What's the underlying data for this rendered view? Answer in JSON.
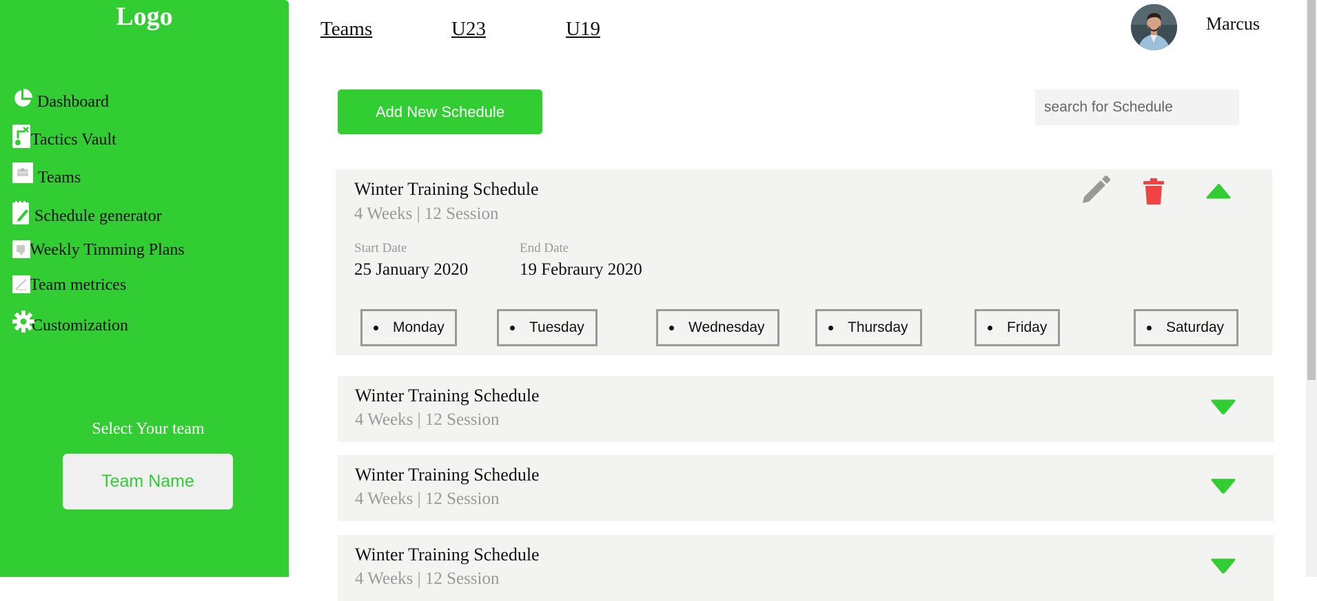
{
  "sidebar": {
    "logo": "Logo",
    "items": [
      {
        "label": "Dashboard",
        "icon": "pie-chart-icon"
      },
      {
        "label": "Tactics Vault",
        "icon": "tactics-board-icon"
      },
      {
        "label": "Teams",
        "icon": "teams-icon"
      },
      {
        "label": "Schedule generator",
        "icon": "notepad-pen-icon"
      },
      {
        "label": "Weekly Timming Plans",
        "icon": "weekly-plan-icon"
      },
      {
        "label": "Team metrices",
        "icon": "metrics-icon"
      },
      {
        "label": "Customization",
        "icon": "gear-icon"
      }
    ],
    "select_label": "Select Your team",
    "team_button": "Team Name"
  },
  "header": {
    "tabs": [
      "Teams",
      "U23",
      "U19"
    ],
    "user_name": "Marcus"
  },
  "toolbar": {
    "add_label": "Add New Schedule",
    "search_placeholder": "search for Schedule"
  },
  "schedules": [
    {
      "title": "Winter Training Schedule",
      "subtitle": "4 Weeks | 12 Session",
      "expanded": true,
      "start_label": "Start Date",
      "start_value": "25 January 2020",
      "end_label": "End Date",
      "end_value": "19 Febraury 2020",
      "days": [
        "Monday",
        "Tuesday",
        "Wednesday",
        "Thursday",
        "Friday",
        "Saturday"
      ]
    },
    {
      "title": "Winter Training Schedule",
      "subtitle": "4 Weeks | 12 Session",
      "expanded": false
    },
    {
      "title": "Winter Training Schedule",
      "subtitle": "4 Weeks | 12 Session",
      "expanded": false
    },
    {
      "title": "Winter Training Schedule",
      "subtitle": "4 Weeks | 12 Session",
      "expanded": false
    }
  ],
  "colors": {
    "accent": "#31cd33",
    "card_bg": "#f3f4f2",
    "delete": "#f04444",
    "edit": "#999999"
  }
}
